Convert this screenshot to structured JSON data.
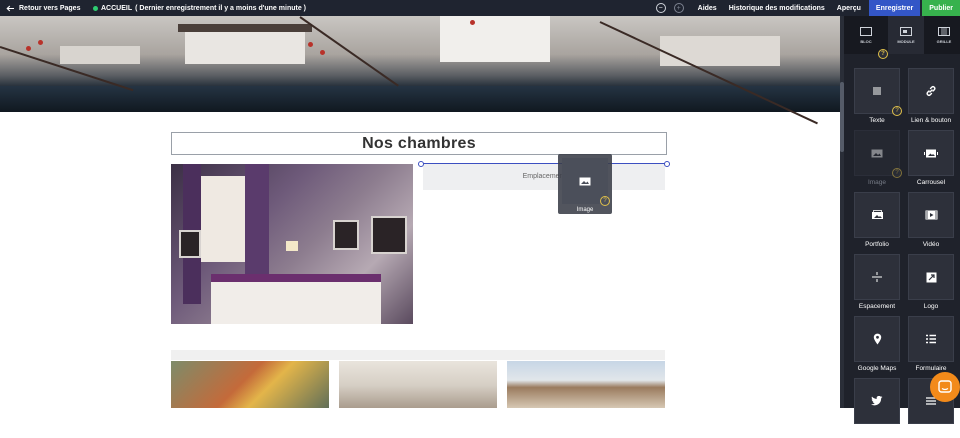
{
  "topbar": {
    "back_label": "Retour vers Pages",
    "page_name": "ACCUEIL",
    "save_status": "( Dernier enregistrement il y a moins d'une minute )",
    "zoom_out": "−",
    "zoom_in": "+",
    "help_label": "Aides",
    "history_label": "Historique des modifications",
    "preview_label": "Aperçu",
    "save_button": "Enregistrer",
    "publish_button": "Publier"
  },
  "canvas": {
    "section_title": "Nos chambres",
    "placeholder_text": "Emplacement",
    "drag_ghost_label": "Image"
  },
  "panel": {
    "tabs": [
      {
        "label": "BLOC",
        "icon": "bloc-icon"
      },
      {
        "label": "MODULE",
        "icon": "module-icon",
        "active": true
      },
      {
        "label": "GRILLE",
        "icon": "grid-icon"
      }
    ],
    "items": [
      {
        "label": "Texte",
        "icon": "text-icon"
      },
      {
        "label": "Lien & bouton",
        "icon": "link-icon"
      },
      {
        "label": "Image",
        "icon": "image-icon",
        "dimmed": true
      },
      {
        "label": "Carrousel",
        "icon": "carousel-icon"
      },
      {
        "label": "Portfolio",
        "icon": "portfolio-icon"
      },
      {
        "label": "Vidéo",
        "icon": "video-icon"
      },
      {
        "label": "Espacement",
        "icon": "spacing-icon"
      },
      {
        "label": "Logo",
        "icon": "logo-icon"
      },
      {
        "label": "Google Maps",
        "icon": "map-pin-icon"
      },
      {
        "label": "Formulaire",
        "icon": "form-icon"
      }
    ],
    "help_badge": "?"
  },
  "colors": {
    "topbar_bg": "#1f2430",
    "save_bg": "#3356c7",
    "publish_bg": "#37b24d",
    "panel_bg": "#1f222b",
    "help_accent": "#e0c04a",
    "drop_line": "#3c4fc1",
    "chat_bubble": "#f28a1a"
  }
}
